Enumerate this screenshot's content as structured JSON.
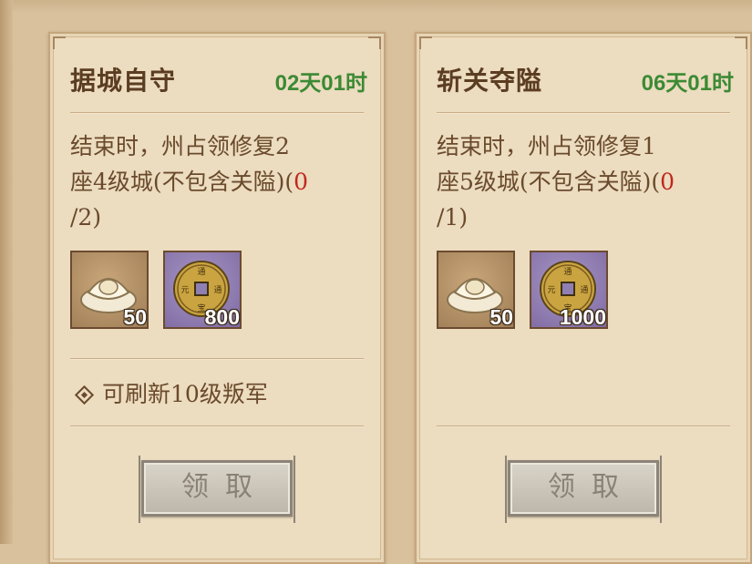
{
  "quests": [
    {
      "title": "据城自守",
      "time_left": "02天01时",
      "desc_line1": "结束时，州占领修复2",
      "desc_line2_a": "座4级城(不包含关隘)(",
      "progress_current": "0",
      "desc_line3": "/2)",
      "rewards": [
        {
          "icon": "silver-ingot-icon",
          "qty": "50"
        },
        {
          "icon": "copper-coin-icon",
          "qty": "800"
        }
      ],
      "unlock_text": "可刷新10级叛军",
      "claim_label": "领取"
    },
    {
      "title": "斩关夺隘",
      "time_left": "06天01时",
      "desc_line1": "结束时，州占领修复1",
      "desc_line2_a": "座5级城(不包含关隘)(",
      "progress_current": "0",
      "desc_line3": "/1)",
      "rewards": [
        {
          "icon": "silver-ingot-icon",
          "qty": "50"
        },
        {
          "icon": "copper-coin-icon",
          "qty": "1000"
        }
      ],
      "unlock_text": "",
      "claim_label": "领取"
    }
  ],
  "colors": {
    "time_green": "#3c8a34",
    "progress_red": "#c0281e",
    "card_bg": "#ecdcc0",
    "title_brown": "#5b3d22"
  }
}
